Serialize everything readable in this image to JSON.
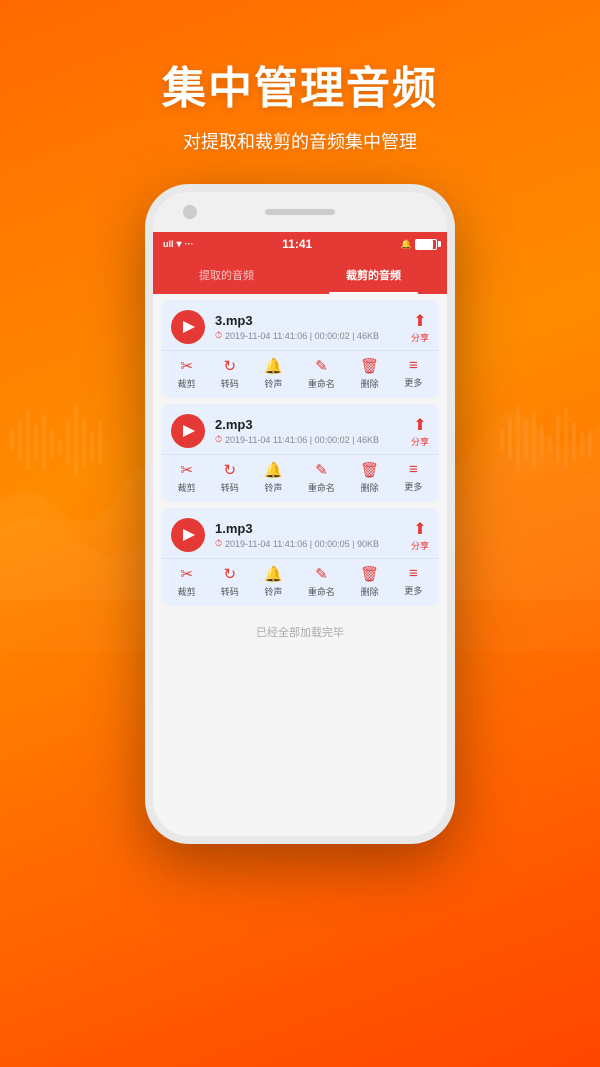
{
  "page": {
    "background_gradient": "linear-gradient(160deg, #ff6a00 0%, #ff8c00 40%, #ff4500 100%)"
  },
  "header": {
    "title": "集中管理音频",
    "subtitle": "对提取和裁剪的音频集中管理"
  },
  "phone": {
    "status_bar": {
      "signal": "딜딜",
      "wifi": "▾",
      "dots": "···",
      "time": "11:41",
      "notification": "🔔",
      "battery_label": ""
    },
    "tabs": [
      {
        "label": "提取的音频",
        "active": false
      },
      {
        "label": "裁剪的音频",
        "active": true
      }
    ],
    "audio_items": [
      {
        "name": "3.mp3",
        "meta": "2019-11-04 11:41:06 | 00:00:02 | 46KB",
        "share_label": "分享",
        "actions": [
          {
            "icon": "✂",
            "label": "裁剪"
          },
          {
            "icon": "↻",
            "label": "转码"
          },
          {
            "icon": "🔔",
            "label": "铃声"
          },
          {
            "icon": "✎",
            "label": "重命名"
          },
          {
            "icon": "🗑",
            "label": "删除"
          },
          {
            "icon": "≡",
            "label": "更多"
          }
        ]
      },
      {
        "name": "2.mp3",
        "meta": "2019-11-04 11:41:06 | 00:00:02 | 46KB",
        "share_label": "分享",
        "actions": [
          {
            "icon": "✂",
            "label": "裁剪"
          },
          {
            "icon": "↻",
            "label": "转码"
          },
          {
            "icon": "🔔",
            "label": "铃声"
          },
          {
            "icon": "✎",
            "label": "重命名"
          },
          {
            "icon": "🗑",
            "label": "删除"
          },
          {
            "icon": "≡",
            "label": "更多"
          }
        ]
      },
      {
        "name": "1.mp3",
        "meta": "2019-11-04 11:41:06 | 00:00:05 | 90KB",
        "share_label": "分享",
        "actions": [
          {
            "icon": "✂",
            "label": "裁剪"
          },
          {
            "icon": "↻",
            "label": "转码"
          },
          {
            "icon": "🔔",
            "label": "铃声"
          },
          {
            "icon": "✎",
            "label": "重命名"
          },
          {
            "icon": "🗑",
            "label": "删除"
          },
          {
            "icon": "≡",
            "label": "更多"
          }
        ]
      }
    ],
    "footer_text": "已经全部加载完毕"
  }
}
